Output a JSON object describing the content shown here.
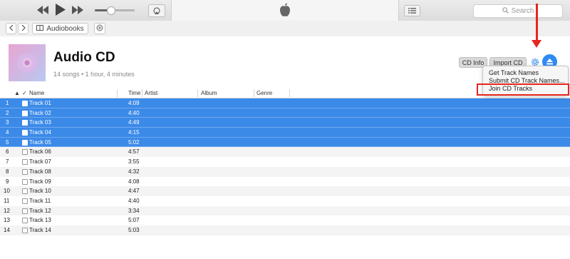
{
  "toolbar": {
    "search_placeholder": "Search"
  },
  "navbar": {
    "library_label": "Audiobooks"
  },
  "header": {
    "title": "Audio CD",
    "subtitle": "14 songs • 1 hour, 4 minutes",
    "cd_info_label": "CD Info",
    "import_cd_label": "Import CD"
  },
  "columns": {
    "name": "Name",
    "time": "Time",
    "artist": "Artist",
    "album": "Album",
    "genre": "Genre"
  },
  "tracks": [
    {
      "num": "1",
      "name": "Track 01",
      "time": "4:09"
    },
    {
      "num": "2",
      "name": "Track 02",
      "time": "4:40"
    },
    {
      "num": "3",
      "name": "Track 03",
      "time": "4:49"
    },
    {
      "num": "4",
      "name": "Track 04",
      "time": "4:15"
    },
    {
      "num": "5",
      "name": "Track 05",
      "time": "5:02"
    },
    {
      "num": "6",
      "name": "Track 06",
      "time": "4:57"
    },
    {
      "num": "7",
      "name": "Track 07",
      "time": "3:55"
    },
    {
      "num": "8",
      "name": "Track 08",
      "time": "4:32"
    },
    {
      "num": "9",
      "name": "Track 09",
      "time": "4:08"
    },
    {
      "num": "10",
      "name": "Track 10",
      "time": "4:47"
    },
    {
      "num": "11",
      "name": "Track 11",
      "time": "4:40"
    },
    {
      "num": "12",
      "name": "Track 12",
      "time": "3:34"
    },
    {
      "num": "13",
      "name": "Track 13",
      "time": "5:07"
    },
    {
      "num": "14",
      "name": "Track 14",
      "time": "5:03"
    }
  ],
  "menu": {
    "items": [
      "Get Track Names",
      "Submit CD Track Names...",
      "Join CD Tracks"
    ]
  },
  "colors": {
    "selection": "#3b8ae8",
    "accent": "#2f8bf3",
    "highlight": "#e8251e"
  },
  "icons": [
    "rewind-icon",
    "play-icon",
    "fast-forward-icon",
    "airplay-icon",
    "apple-logo-icon",
    "list-icon",
    "search-icon",
    "back-icon",
    "forward-icon",
    "cd-icon",
    "gear-icon",
    "eject-icon"
  ]
}
